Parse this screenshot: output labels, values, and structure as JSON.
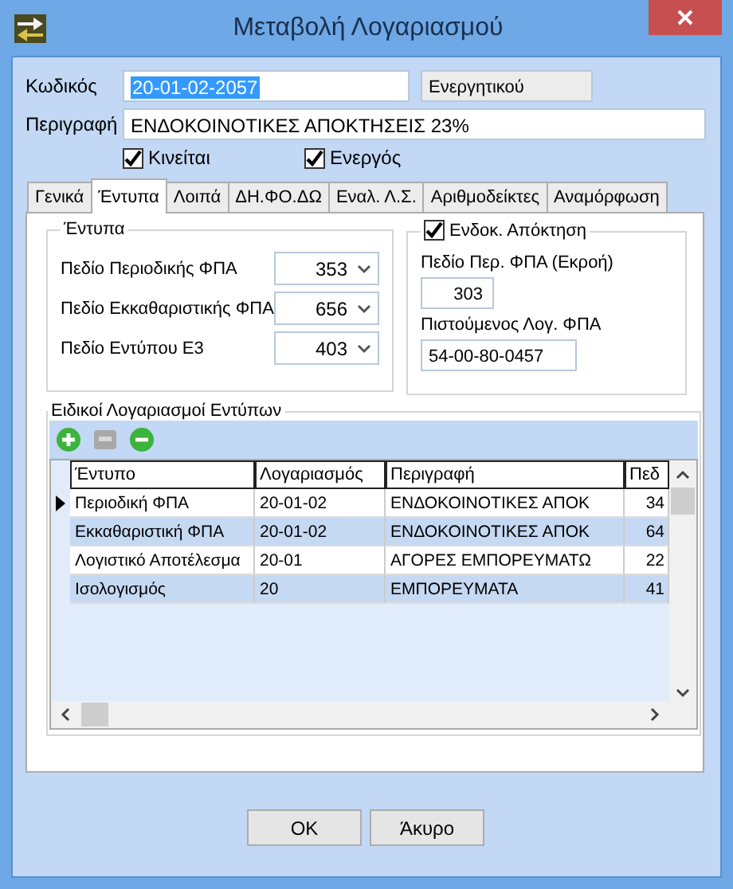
{
  "window": {
    "title": "Μεταβολή Λογαριασμού"
  },
  "code": {
    "label": "Κωδικός",
    "value": "20-01-02-2057",
    "type": "Ενεργητικού"
  },
  "description": {
    "label": "Περιγραφή",
    "value": "ΕΝΔΟΚΟΙΝΟΤΙΚΕΣ ΑΠΟΚΤΗΣΕΙΣ 23%"
  },
  "flags": [
    {
      "label": "Κινείται",
      "checked": true
    },
    {
      "label": "Ενεργός",
      "checked": true
    }
  ],
  "tabs": [
    {
      "label": "Γενικά",
      "selected": false
    },
    {
      "label": "Έντυπα",
      "selected": true
    },
    {
      "label": "Λοιπά",
      "selected": false
    },
    {
      "label": "ΔΗ.ΦΟ.ΔΩ",
      "selected": false
    },
    {
      "label": "Εναλ. Λ.Σ.",
      "selected": false
    },
    {
      "label": "Αριθμοδείκτες",
      "selected": false
    },
    {
      "label": "Αναμόρφωση",
      "selected": false
    }
  ],
  "forms_group": {
    "title": "Έντυπα",
    "fields": [
      {
        "label": "Πεδίο Περιοδικής ΦΠΑ",
        "value": "353"
      },
      {
        "label": "Πεδίο Εκκαθαριστικής ΦΠΑ",
        "value": "656"
      },
      {
        "label": "Πεδίο Εντύπου Ε3",
        "value": "403"
      }
    ]
  },
  "intra_group": {
    "title": "Ενδοκ. Απόκτηση",
    "checked": true,
    "output_label": "Πεδίο Περ. ΦΠΑ (Εκροή)",
    "output_value": "303",
    "credit_label": "Πιστούμενος Λογ. ΦΠΑ",
    "credit_value": "54-00-80-0457"
  },
  "special_accounts": {
    "title": "Ειδικοί Λογαριασμοί Εντύπων",
    "columns": [
      "Έντυπο",
      "Λογαριασμός",
      "Περιγραφή",
      "Πεδ"
    ],
    "rows": [
      {
        "cells": [
          "Περιοδική ΦΠΑ",
          "20-01-02",
          "ΕΝΔΟΚΟΙΝΟΤΙΚΕΣ ΑΠΟΚ",
          "34"
        ],
        "current": true
      },
      {
        "cells": [
          "Εκκαθαριστική ΦΠΑ",
          "20-01-02",
          "ΕΝΔΟΚΟΙΝΟΤΙΚΕΣ ΑΠΟΚ",
          "64"
        ],
        "current": false
      },
      {
        "cells": [
          "Λογιστικό Αποτέλεσμα",
          "20-01",
          "ΑΓΟΡΕΣ ΕΜΠΟΡΕΥΜΑΤΩ",
          "22"
        ],
        "current": false
      },
      {
        "cells": [
          "Ισολογισμός",
          "20",
          "ΕΜΠΟΡΕΥΜΑΤΑ",
          "41"
        ],
        "current": false
      }
    ]
  },
  "buttons": [
    "OK",
    "Άκυρο"
  ]
}
